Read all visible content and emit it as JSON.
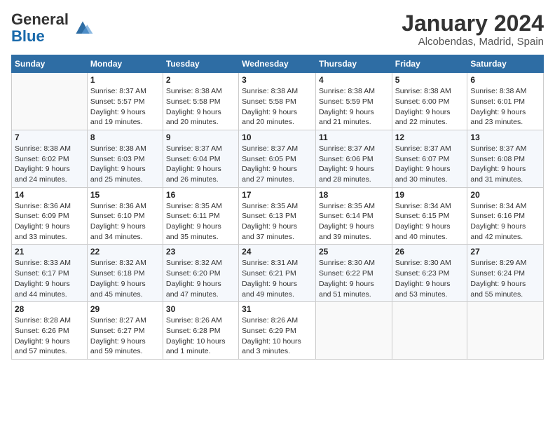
{
  "header": {
    "logo_general": "General",
    "logo_blue": "Blue",
    "title": "January 2024",
    "location": "Alcobendas, Madrid, Spain"
  },
  "columns": [
    "Sunday",
    "Monday",
    "Tuesday",
    "Wednesday",
    "Thursday",
    "Friday",
    "Saturday"
  ],
  "weeks": [
    [
      {
        "day": "",
        "info": ""
      },
      {
        "day": "1",
        "info": "Sunrise: 8:37 AM\nSunset: 5:57 PM\nDaylight: 9 hours\nand 19 minutes."
      },
      {
        "day": "2",
        "info": "Sunrise: 8:38 AM\nSunset: 5:58 PM\nDaylight: 9 hours\nand 20 minutes."
      },
      {
        "day": "3",
        "info": "Sunrise: 8:38 AM\nSunset: 5:58 PM\nDaylight: 9 hours\nand 20 minutes."
      },
      {
        "day": "4",
        "info": "Sunrise: 8:38 AM\nSunset: 5:59 PM\nDaylight: 9 hours\nand 21 minutes."
      },
      {
        "day": "5",
        "info": "Sunrise: 8:38 AM\nSunset: 6:00 PM\nDaylight: 9 hours\nand 22 minutes."
      },
      {
        "day": "6",
        "info": "Sunrise: 8:38 AM\nSunset: 6:01 PM\nDaylight: 9 hours\nand 23 minutes."
      }
    ],
    [
      {
        "day": "7",
        "info": "Sunrise: 8:38 AM\nSunset: 6:02 PM\nDaylight: 9 hours\nand 24 minutes."
      },
      {
        "day": "8",
        "info": "Sunrise: 8:38 AM\nSunset: 6:03 PM\nDaylight: 9 hours\nand 25 minutes."
      },
      {
        "day": "9",
        "info": "Sunrise: 8:37 AM\nSunset: 6:04 PM\nDaylight: 9 hours\nand 26 minutes."
      },
      {
        "day": "10",
        "info": "Sunrise: 8:37 AM\nSunset: 6:05 PM\nDaylight: 9 hours\nand 27 minutes."
      },
      {
        "day": "11",
        "info": "Sunrise: 8:37 AM\nSunset: 6:06 PM\nDaylight: 9 hours\nand 28 minutes."
      },
      {
        "day": "12",
        "info": "Sunrise: 8:37 AM\nSunset: 6:07 PM\nDaylight: 9 hours\nand 30 minutes."
      },
      {
        "day": "13",
        "info": "Sunrise: 8:37 AM\nSunset: 6:08 PM\nDaylight: 9 hours\nand 31 minutes."
      }
    ],
    [
      {
        "day": "14",
        "info": "Sunrise: 8:36 AM\nSunset: 6:09 PM\nDaylight: 9 hours\nand 33 minutes."
      },
      {
        "day": "15",
        "info": "Sunrise: 8:36 AM\nSunset: 6:10 PM\nDaylight: 9 hours\nand 34 minutes."
      },
      {
        "day": "16",
        "info": "Sunrise: 8:35 AM\nSunset: 6:11 PM\nDaylight: 9 hours\nand 35 minutes."
      },
      {
        "day": "17",
        "info": "Sunrise: 8:35 AM\nSunset: 6:13 PM\nDaylight: 9 hours\nand 37 minutes."
      },
      {
        "day": "18",
        "info": "Sunrise: 8:35 AM\nSunset: 6:14 PM\nDaylight: 9 hours\nand 39 minutes."
      },
      {
        "day": "19",
        "info": "Sunrise: 8:34 AM\nSunset: 6:15 PM\nDaylight: 9 hours\nand 40 minutes."
      },
      {
        "day": "20",
        "info": "Sunrise: 8:34 AM\nSunset: 6:16 PM\nDaylight: 9 hours\nand 42 minutes."
      }
    ],
    [
      {
        "day": "21",
        "info": "Sunrise: 8:33 AM\nSunset: 6:17 PM\nDaylight: 9 hours\nand 44 minutes."
      },
      {
        "day": "22",
        "info": "Sunrise: 8:32 AM\nSunset: 6:18 PM\nDaylight: 9 hours\nand 45 minutes."
      },
      {
        "day": "23",
        "info": "Sunrise: 8:32 AM\nSunset: 6:20 PM\nDaylight: 9 hours\nand 47 minutes."
      },
      {
        "day": "24",
        "info": "Sunrise: 8:31 AM\nSunset: 6:21 PM\nDaylight: 9 hours\nand 49 minutes."
      },
      {
        "day": "25",
        "info": "Sunrise: 8:30 AM\nSunset: 6:22 PM\nDaylight: 9 hours\nand 51 minutes."
      },
      {
        "day": "26",
        "info": "Sunrise: 8:30 AM\nSunset: 6:23 PM\nDaylight: 9 hours\nand 53 minutes."
      },
      {
        "day": "27",
        "info": "Sunrise: 8:29 AM\nSunset: 6:24 PM\nDaylight: 9 hours\nand 55 minutes."
      }
    ],
    [
      {
        "day": "28",
        "info": "Sunrise: 8:28 AM\nSunset: 6:26 PM\nDaylight: 9 hours\nand 57 minutes."
      },
      {
        "day": "29",
        "info": "Sunrise: 8:27 AM\nSunset: 6:27 PM\nDaylight: 9 hours\nand 59 minutes."
      },
      {
        "day": "30",
        "info": "Sunrise: 8:26 AM\nSunset: 6:28 PM\nDaylight: 10 hours\nand 1 minute."
      },
      {
        "day": "31",
        "info": "Sunrise: 8:26 AM\nSunset: 6:29 PM\nDaylight: 10 hours\nand 3 minutes."
      },
      {
        "day": "",
        "info": ""
      },
      {
        "day": "",
        "info": ""
      },
      {
        "day": "",
        "info": ""
      }
    ]
  ]
}
